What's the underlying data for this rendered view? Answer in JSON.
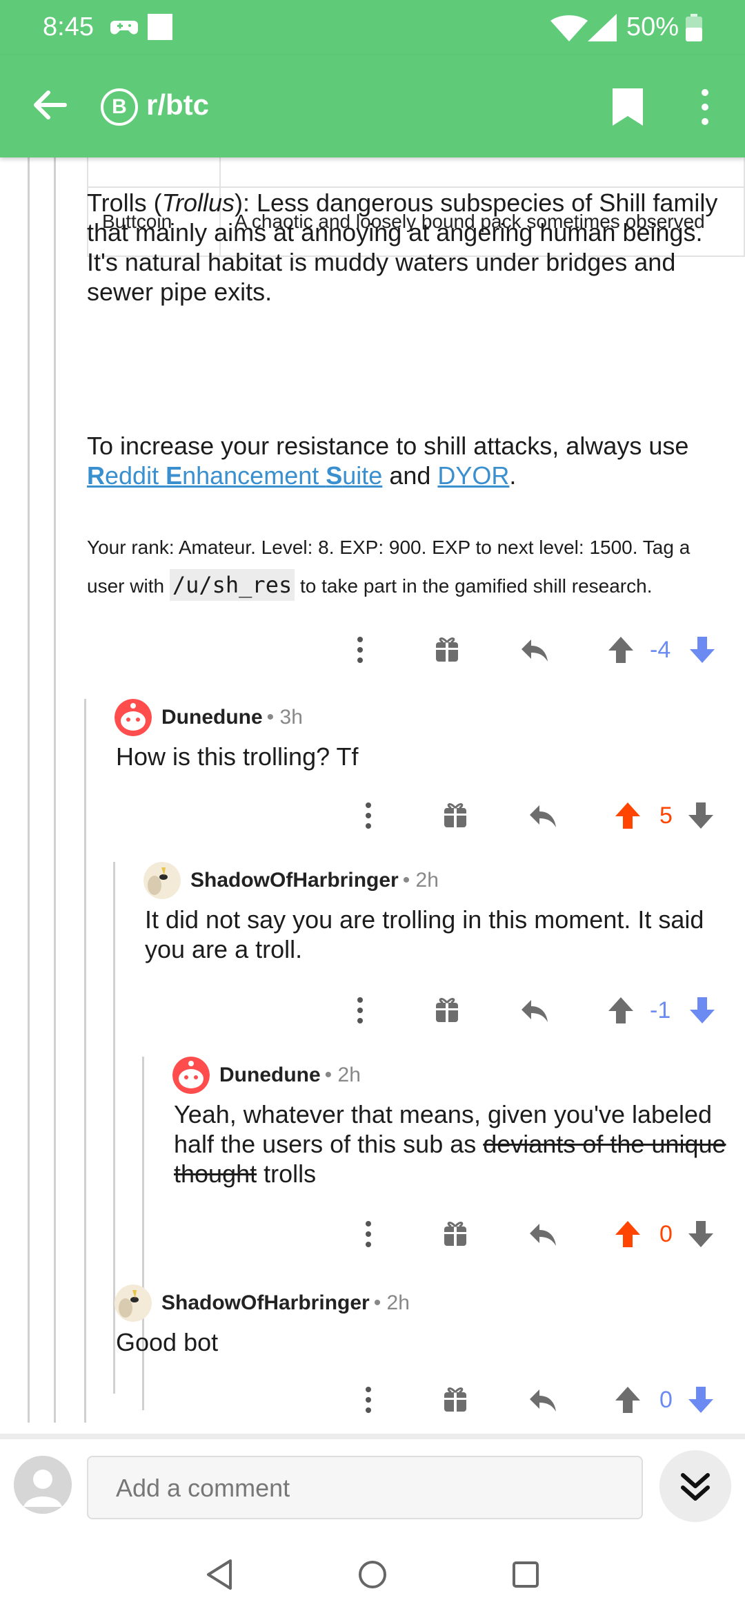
{
  "status_bar": {
    "time": "8:45",
    "battery": "50%"
  },
  "app_bar": {
    "subreddit": "r/btc",
    "sub_icon_letter": "B"
  },
  "table": {
    "row": {
      "name": "Buttcoin",
      "description": "A chaotic and loosely bound pack sometimes observed"
    }
  },
  "para_trolls": {
    "lead": "Trolls (",
    "italic": "Trollus",
    "rest": "): Less dangerous subspecies of Shill family that mainly aims at annoying at angering human beings. It's natural habitat is muddy waters under bridges and sewer pipe exits."
  },
  "para_resist": {
    "lead": "To increase your resistance to shill attacks, always use ",
    "res_R": "R",
    "res_1": "eddit ",
    "res_E": "E",
    "res_2": "nhancement ",
    "res_S": "S",
    "res_3": "uite",
    "mid": " and ",
    "dyor": "DYOR",
    "end": "."
  },
  "rank": {
    "lead": "Your rank: Amateur. Level: 8. EXP: 900. EXP to next level: 1500. Tag a user with ",
    "code": "/u/sh_res",
    "end": " to take part in the gamified shill research."
  },
  "comments": [
    {
      "author": "Dunedune",
      "age": "• 3h",
      "text": "How is this trolling? Tf",
      "score": "5",
      "vote": "up"
    },
    {
      "author": "ShadowOfHarbringer",
      "age": "• 2h",
      "text": "It did not say you are trolling in this moment. It said you are a troll.",
      "score": "-1",
      "vote": "down"
    },
    {
      "author": "Dunedune",
      "age": "• 2h",
      "text_lead": "Yeah, whatever that means, given you've labeled half the users of this sub as ",
      "text_strike": "deviants of the unique thought",
      "text_end": " trolls",
      "score": "0",
      "vote": "up"
    },
    {
      "author": "ShadowOfHarbringer",
      "age": "• 2h",
      "text": "Good bot",
      "score": "0",
      "vote": "down"
    }
  ],
  "parent_score": "-4",
  "composer": {
    "placeholder": "Add a comment"
  },
  "colors": {
    "green": "#5fcb78",
    "upvote": "#ff4500",
    "downvote": "#6b8bf2",
    "link": "#3a8fcf"
  },
  "icons": [
    "back-arrow-icon",
    "bitcoin-icon",
    "bookmark-icon",
    "more-vert-icon",
    "gift-icon",
    "reply-icon",
    "upvote-icon",
    "downvote-icon",
    "chevron-double-down-icon",
    "nav-back-icon",
    "nav-home-icon",
    "nav-recents-icon"
  ]
}
